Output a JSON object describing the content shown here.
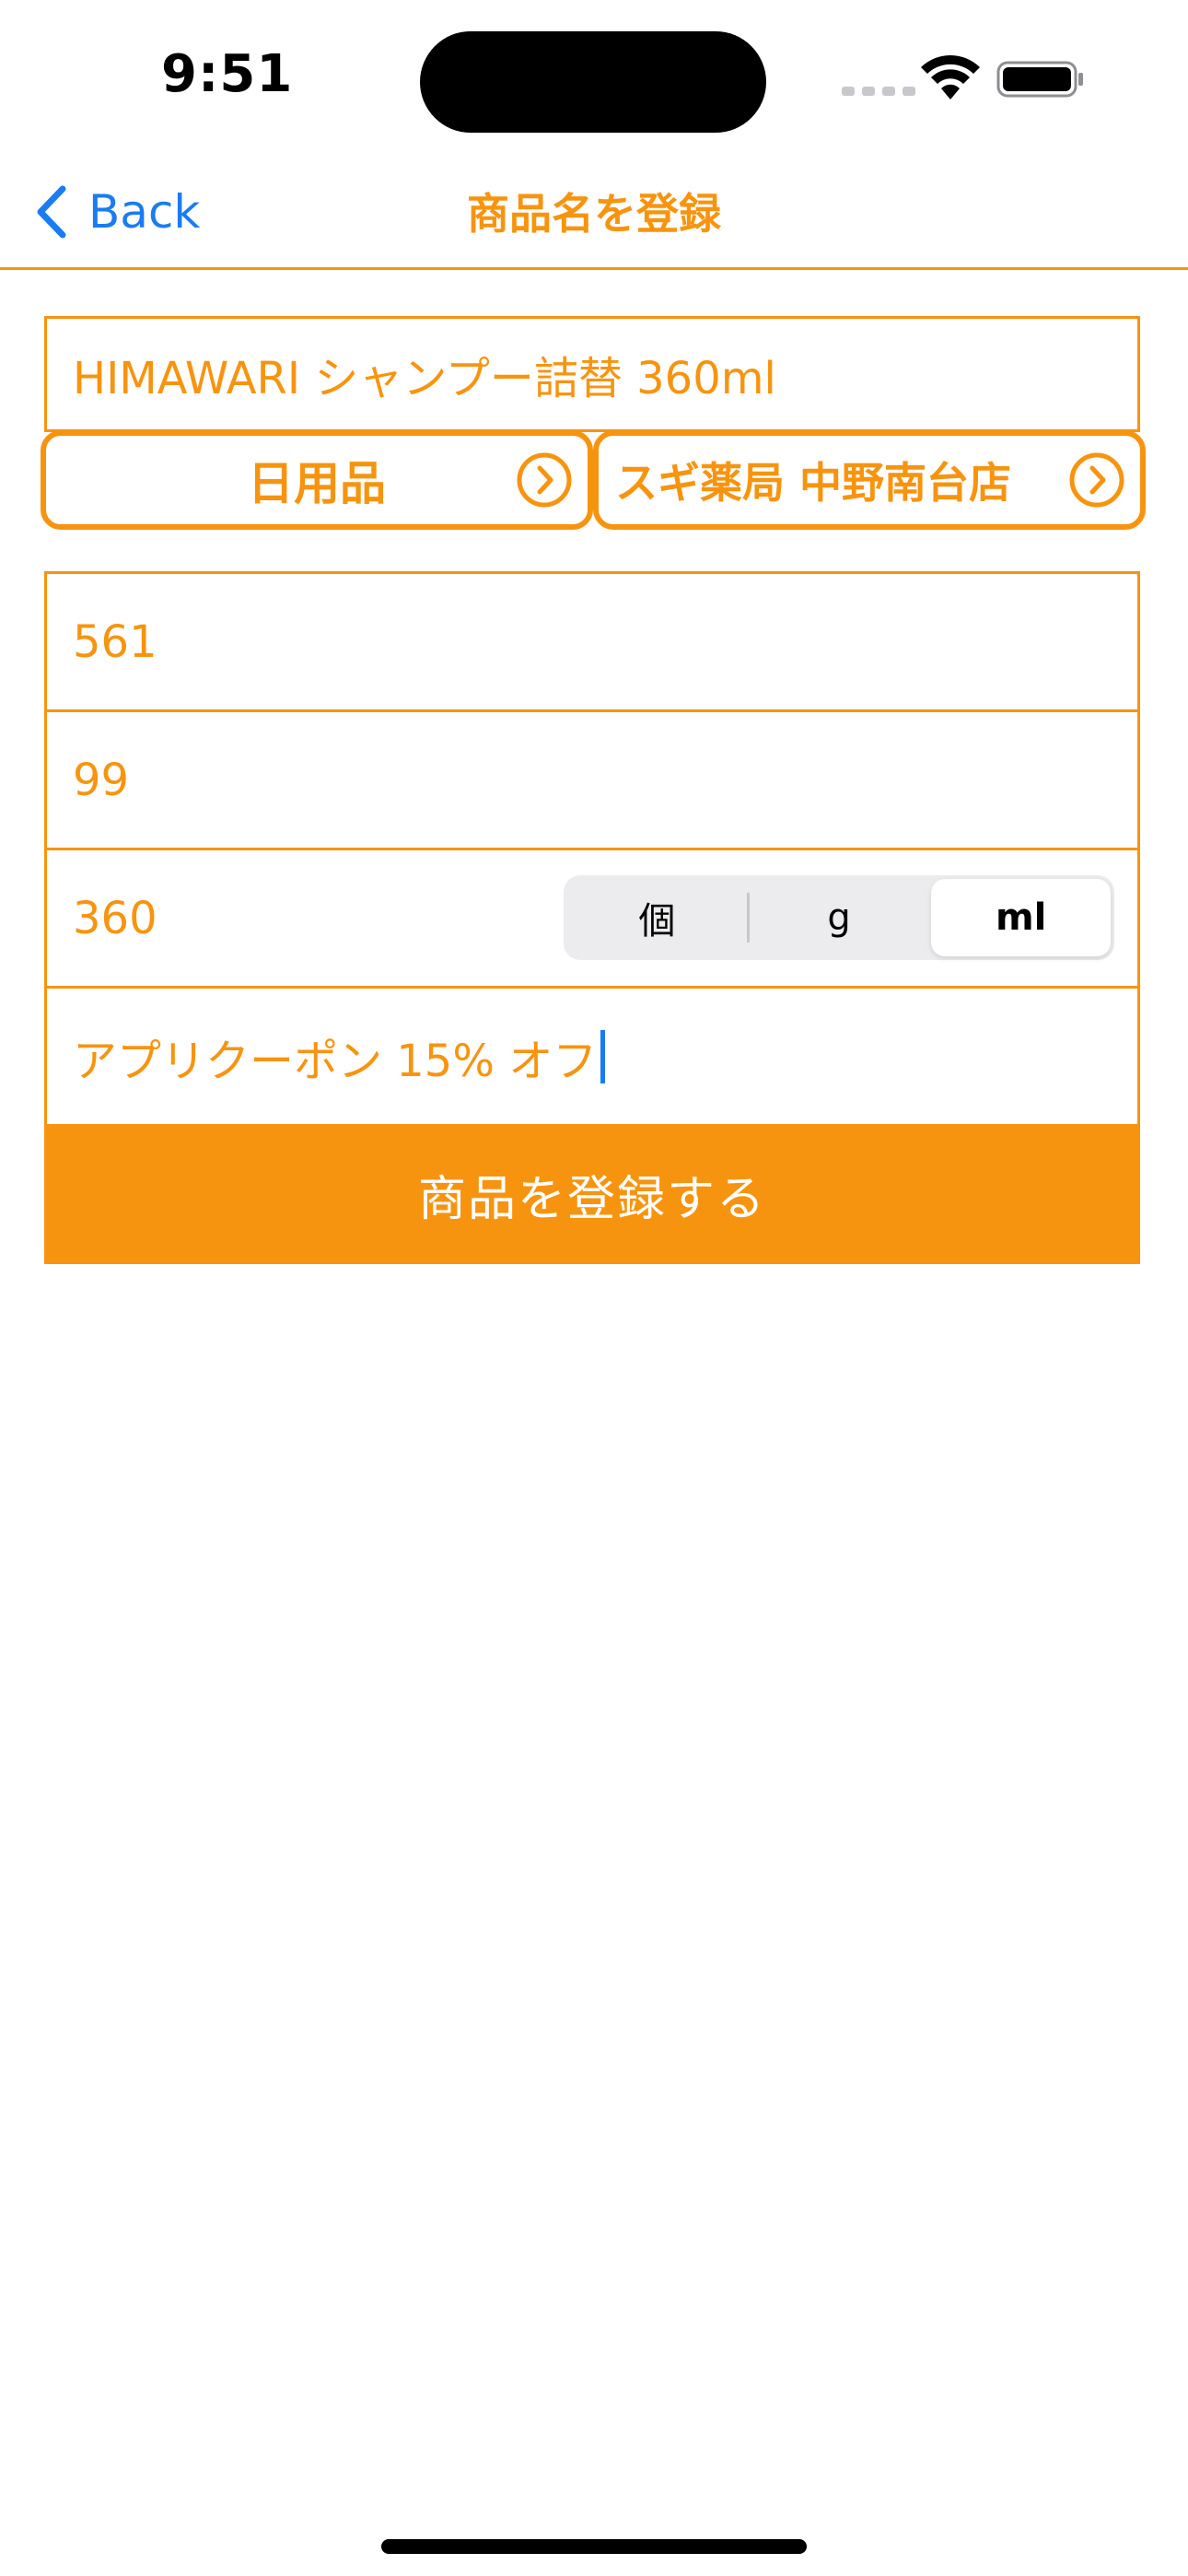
{
  "status_bar": {
    "time": "9:51"
  },
  "nav": {
    "back_label": "Back",
    "title": "商品名を登録"
  },
  "form": {
    "product_name": "HIMAWARI シャンプー詰替 360ml",
    "category": "日用品",
    "store": "スギ薬局 中野南台店",
    "price": "561",
    "discount": "99",
    "amount": "360",
    "unit_options": [
      "個",
      "g",
      "ml"
    ],
    "selected_unit": "ml",
    "memo": "アプリクーポン 15% オフ",
    "submit_label": "商品を登録する"
  },
  "colors": {
    "accent": "#f7940f",
    "link": "#1a7cf2",
    "background": "#ffffff"
  },
  "icons": {
    "back": "chevron-left-icon",
    "disclosure": "chevron-right-circle-icon",
    "wifi": "wifi-icon",
    "battery": "battery-icon"
  }
}
